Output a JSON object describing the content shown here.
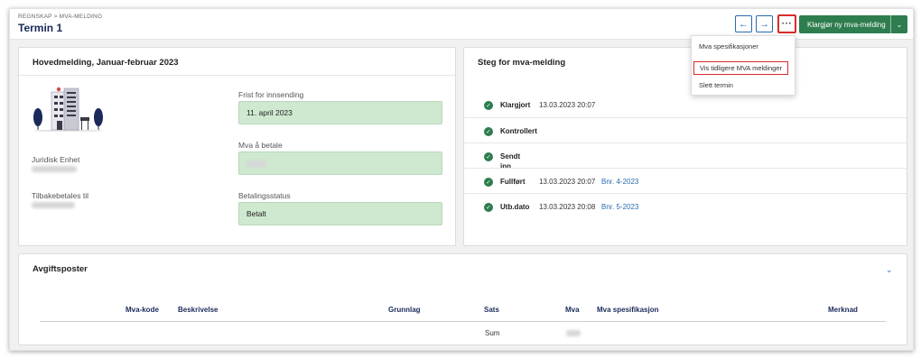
{
  "header": {
    "breadcrumb": "REGNSKAP > MVA-MELDING",
    "title": "Termin 1",
    "nav_prev_icon": "arrow-left-icon",
    "nav_next_icon": "arrow-right-icon",
    "more_label": "···",
    "primary_label": "Klargjør ny mva-melding",
    "primary_caret": "⌄"
  },
  "menu": {
    "items": [
      "Mva spesifikasjoner",
      "Vis tidligere MVA meldinger",
      "Slett termin"
    ]
  },
  "main_card": {
    "title": "Hovedmelding, Januar-februar 2023",
    "juridisk_label": "Juridisk Enhet",
    "tilbake_label": "Tilbakebetales til",
    "frist_label": "Frist for innsending",
    "frist_value": "11. april 2023",
    "mva_label": "Mva å betale",
    "status_label": "Betalingsstatus",
    "status_value": "Betalt"
  },
  "steps_card": {
    "title": "Steg for mva-melding",
    "steps": [
      {
        "name": "Klargjort",
        "time": "13.03.2023 20:07",
        "link": ""
      },
      {
        "name": "Kontrollert",
        "time": "",
        "link": ""
      },
      {
        "name": "Sendt inn",
        "time": "",
        "link": ""
      },
      {
        "name": "Fullført",
        "time": "13.03.2023 20:07",
        "link": "Bnr. 4-2023"
      },
      {
        "name": "Utb.dato",
        "time": "13.03.2023 20:08",
        "link": "Bnr. 5-2023"
      }
    ]
  },
  "avgift": {
    "title": "Avgiftsposter",
    "columns": [
      "Mva-kode",
      "Beskrivelse",
      "Grunnlag",
      "Sats",
      "Mva",
      "Mva spesifikasjon",
      "Merknad"
    ],
    "sum_label": "Sum"
  },
  "colors": {
    "accent_green": "#2e7d4f",
    "highlight_red": "#d92b2b",
    "link_blue": "#2b6cb0",
    "field_green": "#cfe8d0"
  }
}
